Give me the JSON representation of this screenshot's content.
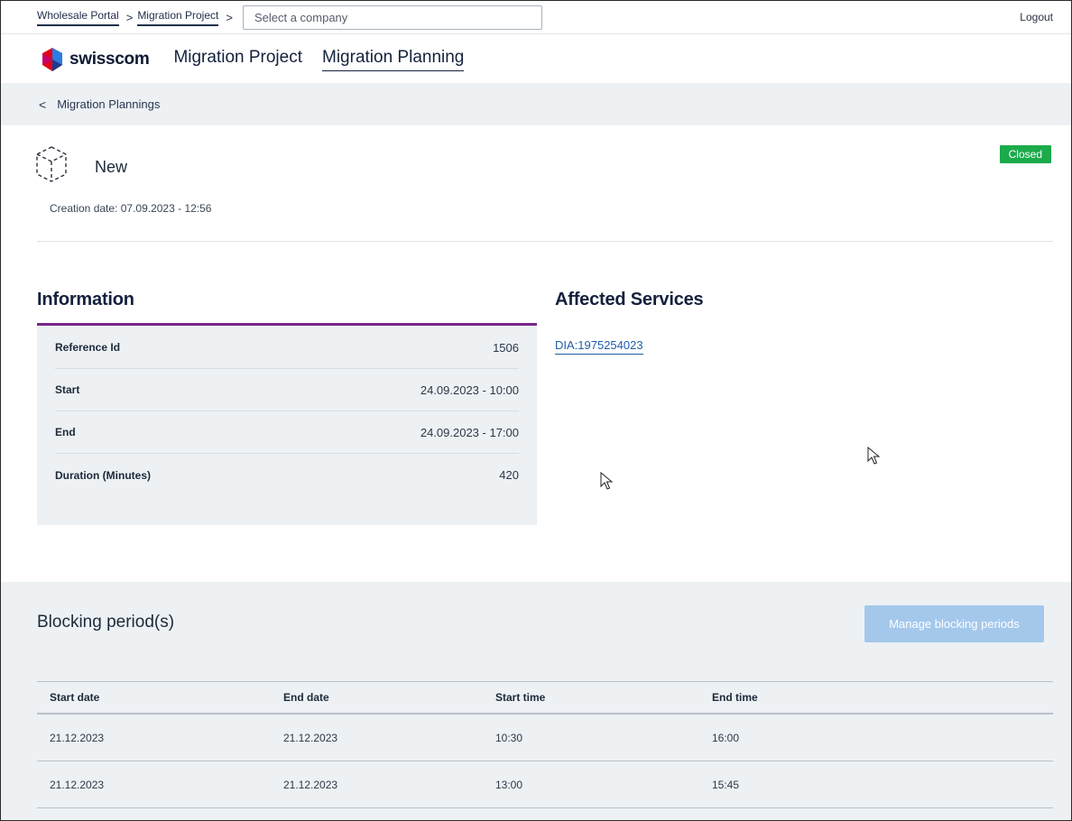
{
  "topbar": {
    "breadcrumb": [
      {
        "label": "Wholesale Portal"
      },
      {
        "label": "Migration Project"
      }
    ],
    "separator": ">",
    "company_placeholder": "Select a company",
    "logout_label": "Logout"
  },
  "brand": {
    "logo_text": "swisscom",
    "nav": [
      {
        "label": "Migration Project",
        "active": false
      },
      {
        "label": "Migration Planning",
        "active": true
      }
    ]
  },
  "back": {
    "chevron": "<",
    "label": "Migration Plannings"
  },
  "header": {
    "icon": "cube-icon",
    "title": "New",
    "status": "Closed",
    "status_color": "#1bab4b",
    "creation_date": "Creation date: 07.09.2023 - 12:56"
  },
  "information": {
    "heading": "Information",
    "accent_color": "#7a2488",
    "rows": [
      {
        "label": "Reference Id",
        "value": "1506"
      },
      {
        "label": "Start",
        "value": "24.09.2023 - 10:00"
      },
      {
        "label": "End",
        "value": "24.09.2023 - 17:00"
      },
      {
        "label": "Duration (Minutes)",
        "value": "420"
      }
    ]
  },
  "affected_services": {
    "heading": "Affected Services",
    "links": [
      "DIA:1975254023"
    ]
  },
  "blocking": {
    "heading": "Blocking period(s)",
    "manage_label": "Manage blocking periods",
    "columns": [
      "Start date",
      "End date",
      "Start time",
      "End time"
    ],
    "rows": [
      [
        "21.12.2023",
        "21.12.2023",
        "10:30",
        "16:00"
      ],
      [
        "21.12.2023",
        "21.12.2023",
        "13:00",
        "15:45"
      ]
    ]
  }
}
